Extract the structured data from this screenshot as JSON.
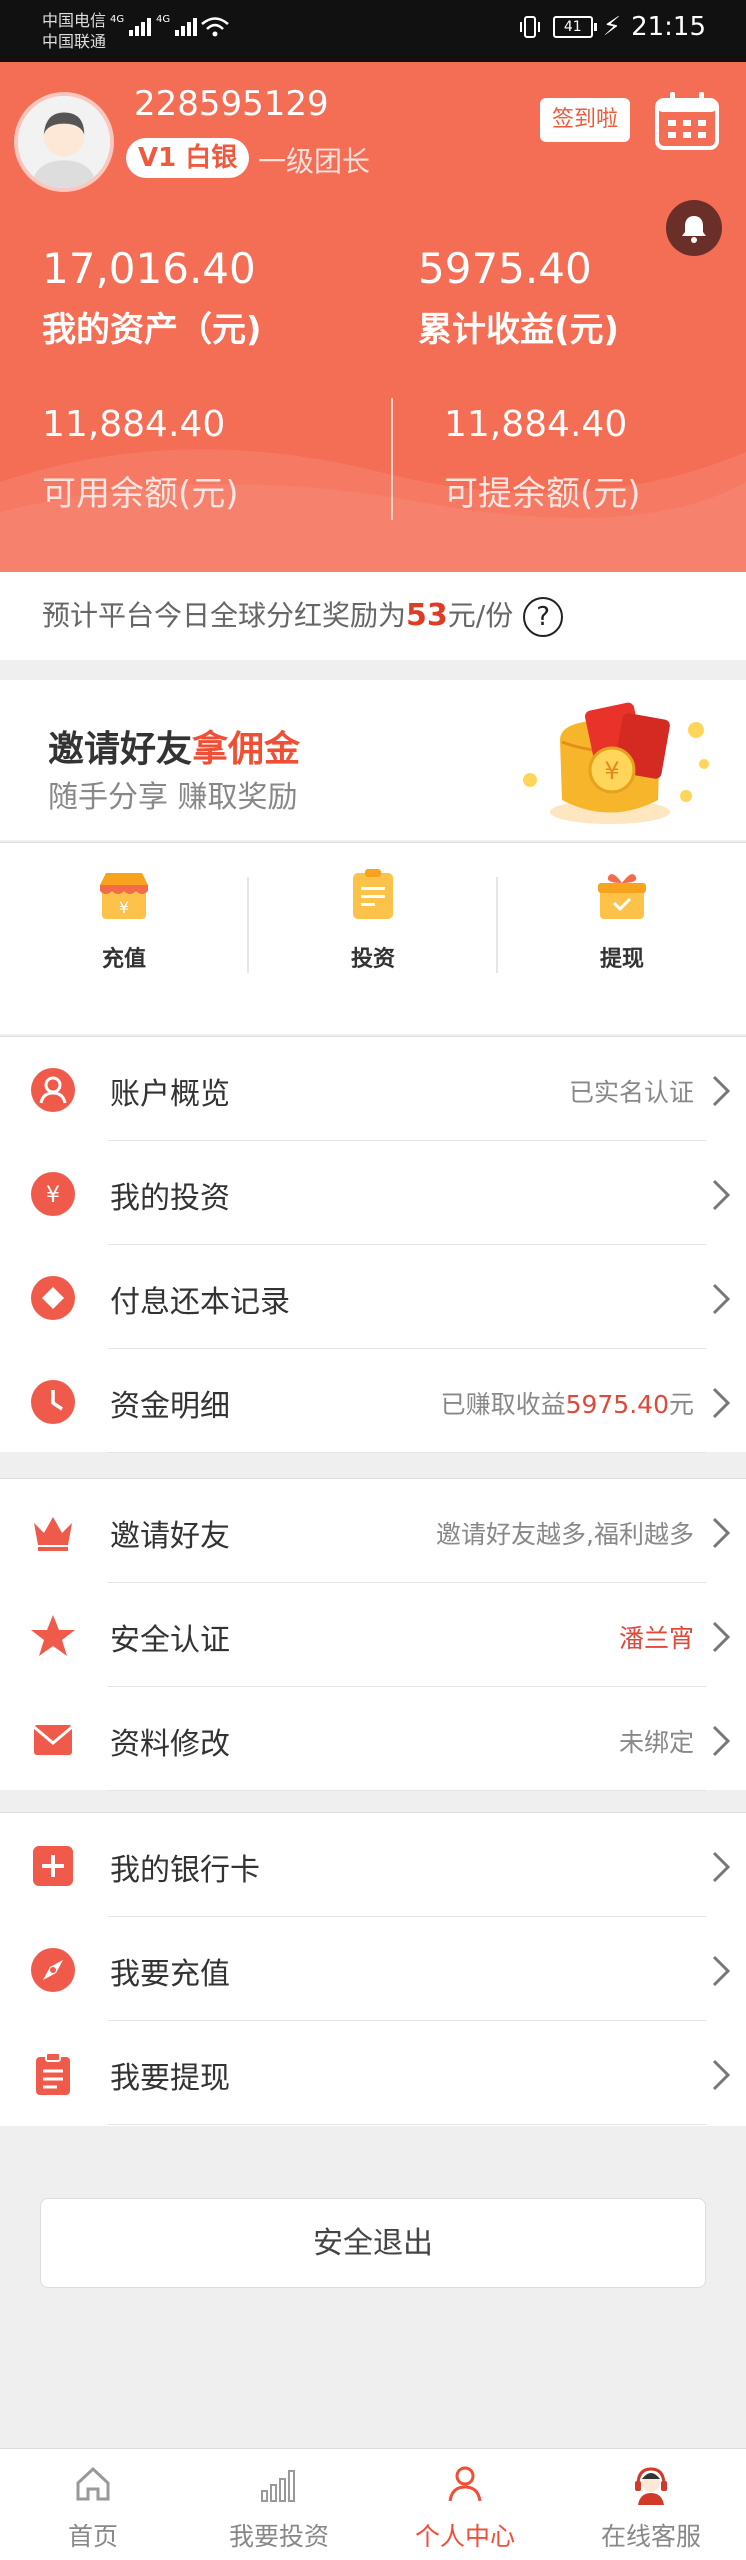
{
  "status_bar": {
    "carrier1": "中国电信",
    "carrier2": "中国联通",
    "net1": "4G",
    "net2": "4G",
    "battery": "41",
    "time": "21:15"
  },
  "header": {
    "username": "228595129",
    "level_badge": "V1 白银",
    "level_title": "一级团长",
    "checkin_label": "签到啦",
    "total_assets_value": "17,016.40",
    "total_assets_label": "我的资产（元)",
    "total_income_value": "5975.40",
    "total_income_label": "累计收益(元)",
    "available_value": "11,884.40",
    "available_label": "可用余额(元)",
    "withdrawable_value": "11,884.40",
    "withdrawable_label": "可提余额(元)"
  },
  "notice": {
    "prefix": "预计平台今日全球分红奖励为",
    "amount": "53",
    "suffix": "元/份",
    "help": "?"
  },
  "invite": {
    "title_main": "邀请好友",
    "title_accent": "拿佣金",
    "subtitle": "随手分享 赚取奖励"
  },
  "quick_actions": [
    {
      "label": "充值",
      "icon": "shop-icon"
    },
    {
      "label": "投资",
      "icon": "clipboard-icon"
    },
    {
      "label": "提现",
      "icon": "gift-icon"
    }
  ],
  "menu1": [
    {
      "label": "账户概览",
      "value": "已实名认证",
      "icon": "user-icon"
    },
    {
      "label": "我的投资",
      "value": "",
      "icon": "yuan-icon"
    },
    {
      "label": "付息还本记录",
      "value": "",
      "icon": "diamond-icon"
    },
    {
      "label": "资金明细",
      "value_prefix": "已赚取收益",
      "value_amount": "5975.40",
      "value_suffix": "元",
      "icon": "clock-icon"
    }
  ],
  "menu2": [
    {
      "label": "邀请好友",
      "value": "邀请好友越多,福利越多",
      "icon": "crown-icon"
    },
    {
      "label": "安全认证",
      "value": "潘兰宵",
      "icon": "star-icon"
    },
    {
      "label": "资料修改",
      "value": "未绑定",
      "icon": "mail-icon"
    }
  ],
  "menu3": [
    {
      "label": "我的银行卡",
      "icon": "plus-card-icon"
    },
    {
      "label": "我要充值",
      "icon": "compass-icon"
    },
    {
      "label": "我要提现",
      "icon": "list-icon"
    }
  ],
  "logout_label": "安全退出",
  "tabs": [
    {
      "label": "首页",
      "icon": "home-icon"
    },
    {
      "label": "我要投资",
      "icon": "bar-chart-icon"
    },
    {
      "label": "个人中心",
      "icon": "person-icon"
    },
    {
      "label": "在线客服",
      "icon": "support-agent-icon"
    }
  ],
  "colors": {
    "brand": "#f46d55",
    "accent_red": "#e0483a",
    "gold": "#f7b52c"
  }
}
